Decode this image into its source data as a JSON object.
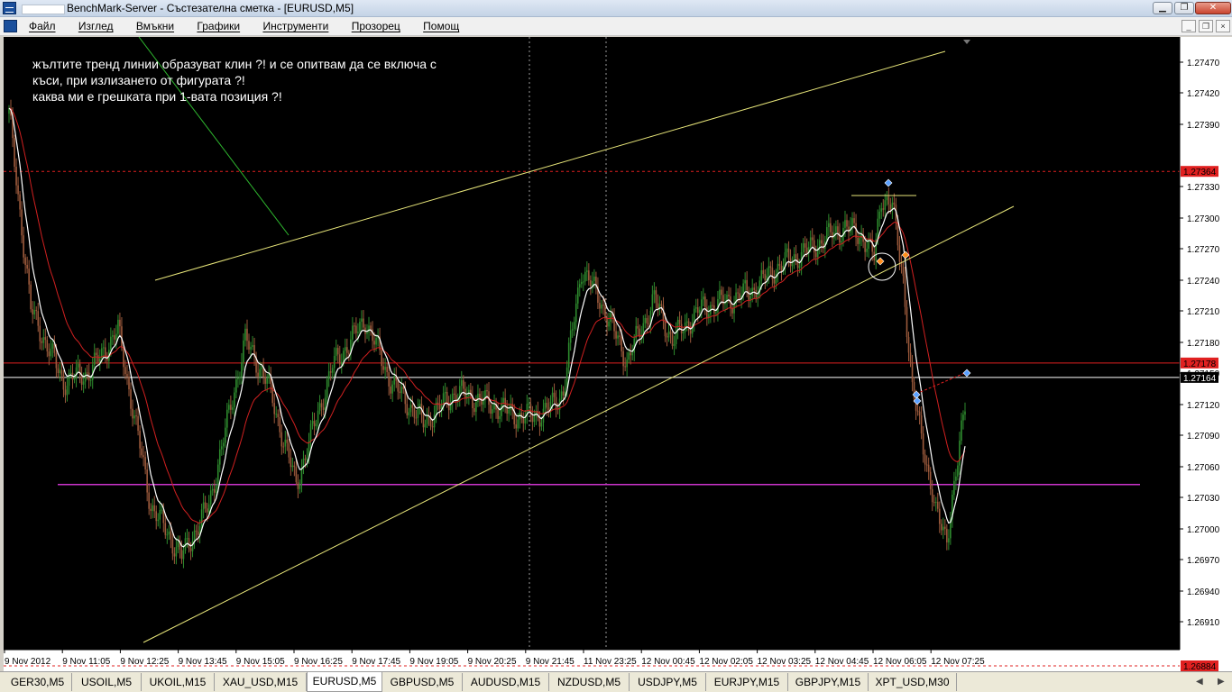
{
  "window": {
    "title": "BenchMark-Server - Състезателна сметка - [EURUSD,M5]",
    "controls": [
      "▁",
      "❐",
      "✕"
    ]
  },
  "menu": {
    "items": [
      "Файл",
      "Изглед",
      "Вмъкни",
      "Графики",
      "Инструменти",
      "Прозорец",
      "Помощ"
    ],
    "mdi_controls": [
      "_",
      "❐",
      "×"
    ]
  },
  "chart": {
    "symbol": "EURUSD",
    "timeframe": "M5",
    "annotation": [
      "жълтите тренд линии образуват клин ?! и се опитвам да се включа с",
      "къси, при излизането от фигурата ?!",
      "каква ми е грешката при 1-вата позиция ?!"
    ],
    "price_ticks": [
      "1.27470",
      "1.27420",
      "1.27390",
      "1.27330",
      "1.27300",
      "1.27270",
      "1.27240",
      "1.27210",
      "1.27180",
      "1.27150",
      "1.27120",
      "1.27090",
      "1.27060",
      "1.27030",
      "1.27000",
      "1.26970",
      "1.26940",
      "1.26910"
    ],
    "time_ticks": [
      "9 Nov 2012",
      "9 Nov 11:05",
      "9 Nov 12:25",
      "9 Nov 13:45",
      "9 Nov 15:05",
      "9 Nov 16:25",
      "9 Nov 17:45",
      "9 Nov 19:05",
      "9 Nov 20:25",
      "9 Nov 21:45",
      "11 Nov 23:25",
      "12 Nov 00:45",
      "12 Nov 02:05",
      "12 Nov 03:25",
      "12 Nov 04:45",
      "12 Nov 06:05",
      "12 Nov 07:25"
    ],
    "price_labels": {
      "upper_level": "1.27364",
      "red_level": "1.27178",
      "bid": "1.27164",
      "lower_level": "1.26884"
    },
    "colors": {
      "background": "#000000",
      "bull_candle": "#2e8b2e",
      "bear_candle": "#9c5a3c",
      "trend_lines": "#e8e67a",
      "ma_fast": "#ffffff",
      "ma_slow": "#d02020",
      "red_level": "#e02020",
      "bid_line": "#ffffff",
      "magenta_level": "#cc33cc",
      "green_line": "#2fb82f"
    }
  },
  "tabs": {
    "items": [
      "GER30,M5",
      "USOIL,M5",
      "UKOIL,M15",
      "XAU_USD,M15",
      "EURUSD,M5",
      "GBPUSD,M5",
      "AUDUSD,M15",
      "NZDUSD,M5",
      "USDJPY,M5",
      "EURJPY,M15",
      "GBPJPY,M15",
      "XPT_USD,M30"
    ],
    "active": "EURUSD,M5"
  }
}
